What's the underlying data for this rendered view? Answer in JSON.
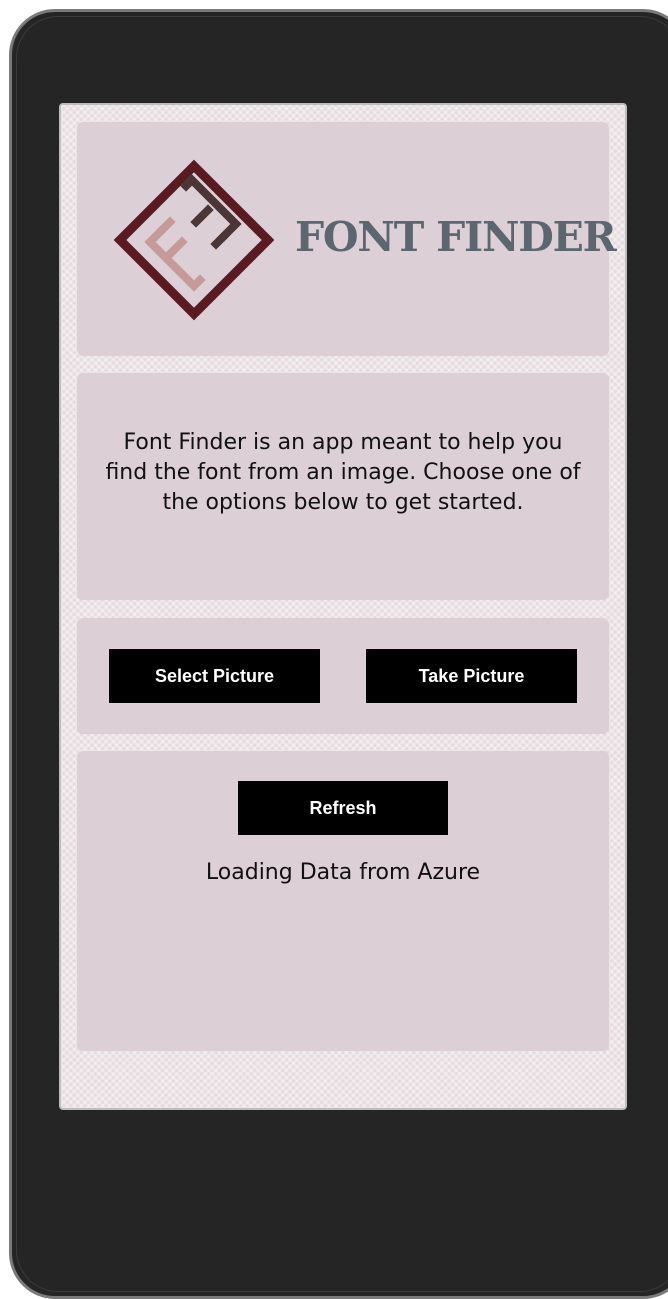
{
  "app": {
    "logo_icon": "font-finder-diamond-logo",
    "logo_text": "FONT FINDER"
  },
  "intro": {
    "text": "Font Finder is an app meant to help you find the font from an image. Choose one of the options below to get started."
  },
  "actions": {
    "select_label": "Select Picture",
    "take_label": "Take Picture"
  },
  "status": {
    "refresh_label": "Refresh",
    "message": "Loading Data from Azure"
  },
  "colors": {
    "logo_text": "#5c666e",
    "logo_dark": "#5a1a22",
    "logo_pink": "#c79a9a",
    "logo_brown": "#4a3537",
    "button_bg": "#000000",
    "card_bg": "#dccfd5"
  }
}
